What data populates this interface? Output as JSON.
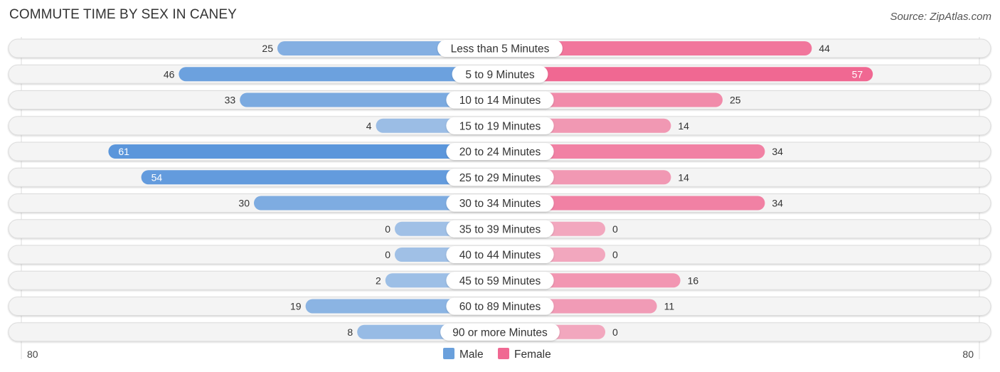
{
  "title": "COMMUTE TIME BY SEX IN CANEY",
  "source": "Source: ZipAtlas.com",
  "chart_data": {
    "type": "bar",
    "orientation": "horizontal-diverging",
    "title": "COMMUTE TIME BY SEX IN CANEY",
    "categories": [
      "Less than 5 Minutes",
      "5 to 9 Minutes",
      "10 to 14 Minutes",
      "15 to 19 Minutes",
      "20 to 24 Minutes",
      "25 to 29 Minutes",
      "30 to 34 Minutes",
      "35 to 39 Minutes",
      "40 to 44 Minutes",
      "45 to 59 Minutes",
      "60 to 89 Minutes",
      "90 or more Minutes"
    ],
    "series": [
      {
        "name": "Male",
        "color": "#6aa0dc",
        "values": [
          25,
          46,
          33,
          4,
          61,
          54,
          30,
          0,
          0,
          2,
          19,
          8
        ]
      },
      {
        "name": "Female",
        "color": "#f06892",
        "values": [
          44,
          57,
          25,
          14,
          34,
          14,
          34,
          0,
          0,
          16,
          11,
          0
        ]
      }
    ],
    "axis": {
      "left_label": "80",
      "right_label": "80",
      "range": [
        0,
        80
      ]
    },
    "legend": {
      "position": "bottom-center",
      "items": [
        "Male",
        "Female"
      ]
    }
  }
}
